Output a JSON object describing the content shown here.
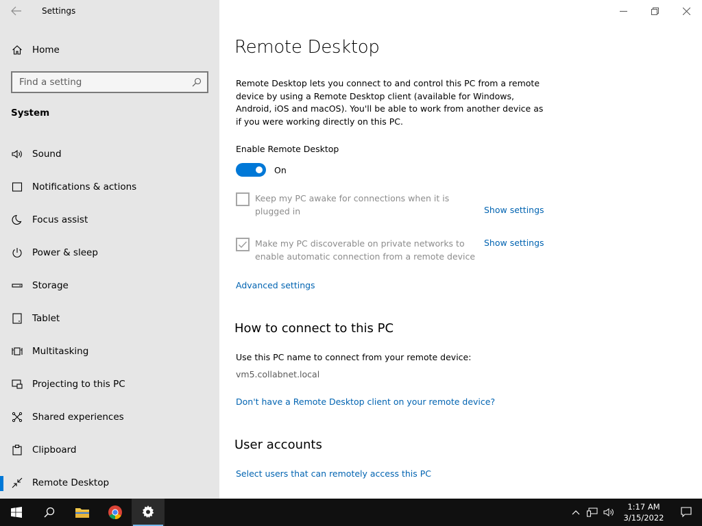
{
  "window": {
    "title": "Settings"
  },
  "sidebar": {
    "home_label": "Home",
    "search_placeholder": "Find a setting",
    "section": "System",
    "items": [
      {
        "label": "Sound",
        "icon": "speaker-icon"
      },
      {
        "label": "Notifications & actions",
        "icon": "message-icon"
      },
      {
        "label": "Focus assist",
        "icon": "moon-icon"
      },
      {
        "label": "Power & sleep",
        "icon": "power-icon"
      },
      {
        "label": "Storage",
        "icon": "storage-icon"
      },
      {
        "label": "Tablet",
        "icon": "tablet-icon"
      },
      {
        "label": "Multitasking",
        "icon": "multitasking-icon"
      },
      {
        "label": "Projecting to this PC",
        "icon": "projecting-icon"
      },
      {
        "label": "Shared experiences",
        "icon": "shared-icon"
      },
      {
        "label": "Clipboard",
        "icon": "clipboard-icon"
      },
      {
        "label": "Remote Desktop",
        "icon": "remote-desktop-icon",
        "active": true
      }
    ]
  },
  "main": {
    "title": "Remote Desktop",
    "description": "Remote Desktop lets you connect to and control this PC from a remote device by using a Remote Desktop client (available for Windows, Android, iOS and macOS). You'll be able to work from another device as if you were working directly on this PC.",
    "enable_label": "Enable Remote Desktop",
    "toggle_state": "On",
    "toggle_on": true,
    "option_awake": {
      "label": "Keep my PC awake for connections when it is plugged in",
      "checked": false,
      "link": "Show settings"
    },
    "option_discoverable": {
      "label": "Make my PC discoverable on private networks to enable automatic connection from a remote device",
      "checked": true,
      "link": "Show settings"
    },
    "advanced_link": "Advanced settings",
    "connect_heading": "How to connect to this PC",
    "connect_text": "Use this PC name to connect from your remote device:",
    "pc_name": "vm5.collabnet.local",
    "client_link": "Don't have a Remote Desktop client on your remote device?",
    "accounts_heading": "User accounts",
    "accounts_link": "Select users that can remotely access this PC"
  },
  "taskbar": {
    "time": "1:17 AM",
    "date": "3/15/2022"
  },
  "colors": {
    "accent": "#0078d7",
    "link": "#0063b1",
    "sidebar_bg": "#e6e6e6",
    "taskbar_bg": "#101010"
  }
}
